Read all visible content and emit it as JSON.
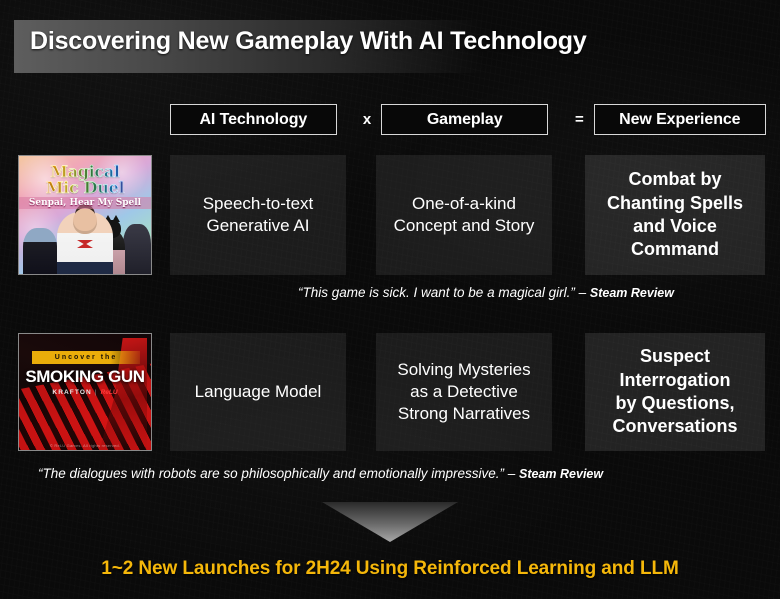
{
  "slide": {
    "title": "Discovering New Gameplay With AI Technology",
    "background_color": "#0a0a0a"
  },
  "equation_row": {
    "term1": "AI Technology",
    "operator_multiply": "x",
    "term2": "Gameplay",
    "operator_equals": "=",
    "term3": "New Experience"
  },
  "rows": [
    {
      "cover": {
        "title_line1": "Magical",
        "title_line2": "Mic Duel",
        "subtitle": "Senpai, Hear My Spell"
      },
      "ai_technology": "Speech-to-text\nGenerative AI",
      "ai_technology_line1": "Speech-to-text",
      "ai_technology_line2": "Generative AI",
      "gameplay_line1": "One-of-a-kind",
      "gameplay_line2": "Concept and Story",
      "new_experience_line1": "Combat by",
      "new_experience_line2": "Chanting Spells",
      "new_experience_line3": "and Voice",
      "new_experience_line4": "Command",
      "quote": "“This game is sick. I want to be a magical girl.”",
      "quote_dash": "–",
      "quote_source": "Steam Review"
    },
    {
      "cover": {
        "kicker": "Uncover the",
        "title": "SMOKING GUN",
        "publisher": "KRAFTON",
        "separator": "|",
        "studio": "ReLU",
        "footer": "© ReLU Games. All rights reserved."
      },
      "ai_technology_line1": "Language Model",
      "gameplay_line1": "Solving Mysteries",
      "gameplay_line2": "as a Detective",
      "gameplay_line3": "Strong Narratives",
      "new_experience_line1": "Suspect",
      "new_experience_line2": "Interrogation",
      "new_experience_line3": "by Questions,",
      "new_experience_line4": "Conversations",
      "quote": "“The dialogues with robots  are so philosophically and emotionally impressive.”",
      "quote_dash": "–",
      "quote_source": "Steam Review"
    }
  ],
  "banner": {
    "text": "1~2 New Launches for 2H24 Using Reinforced Learning and LLM",
    "color": "#f5b70a"
  }
}
